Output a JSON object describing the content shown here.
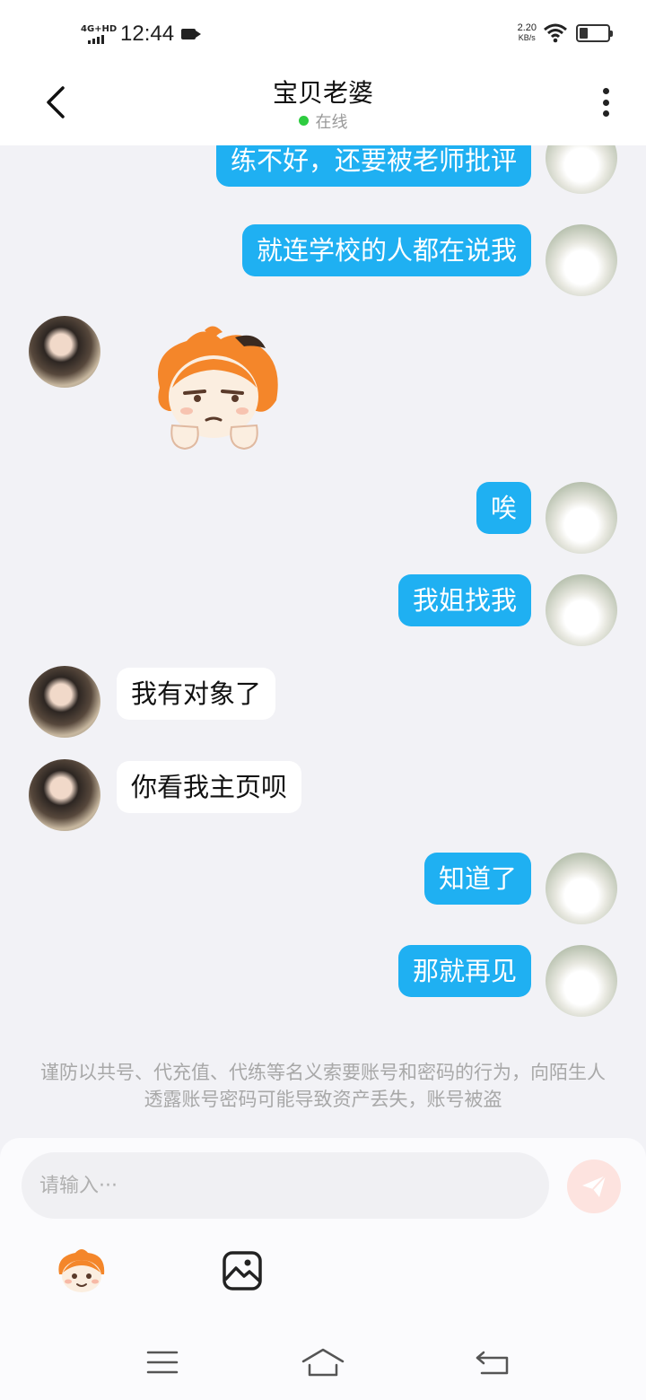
{
  "status_bar": {
    "network": "4G+HD",
    "time": "12:44",
    "speed_value": "2.20",
    "speed_unit": "KB/s",
    "battery_level": 0.3
  },
  "header": {
    "title": "宝贝老婆",
    "status": "在线"
  },
  "messages": [
    {
      "side": "mine",
      "text": "练不好，还要被老师批评"
    },
    {
      "side": "mine",
      "text": "就连学校的人都在说我"
    },
    {
      "side": "theirs",
      "type": "sticker",
      "icon": "grumpy-mascot-sticker"
    },
    {
      "side": "mine",
      "text": "唉"
    },
    {
      "side": "mine",
      "text": "我姐找我"
    },
    {
      "side": "theirs",
      "text": "我有对象了"
    },
    {
      "side": "theirs",
      "text": "你看我主页呗"
    },
    {
      "side": "mine",
      "text": "知道了"
    },
    {
      "side": "mine",
      "text": "那就再见"
    }
  ],
  "notice": "谨防以共号、代充值、代练等名义索要账号和密码的行为，向陌生人透露账号密码可能导致资产丢失，账号被盗",
  "input": {
    "placeholder": "请输入···"
  },
  "colors": {
    "mine_bubble": "#1fb0f2",
    "send_button": "#fde3df",
    "online": "#2ecc40"
  }
}
